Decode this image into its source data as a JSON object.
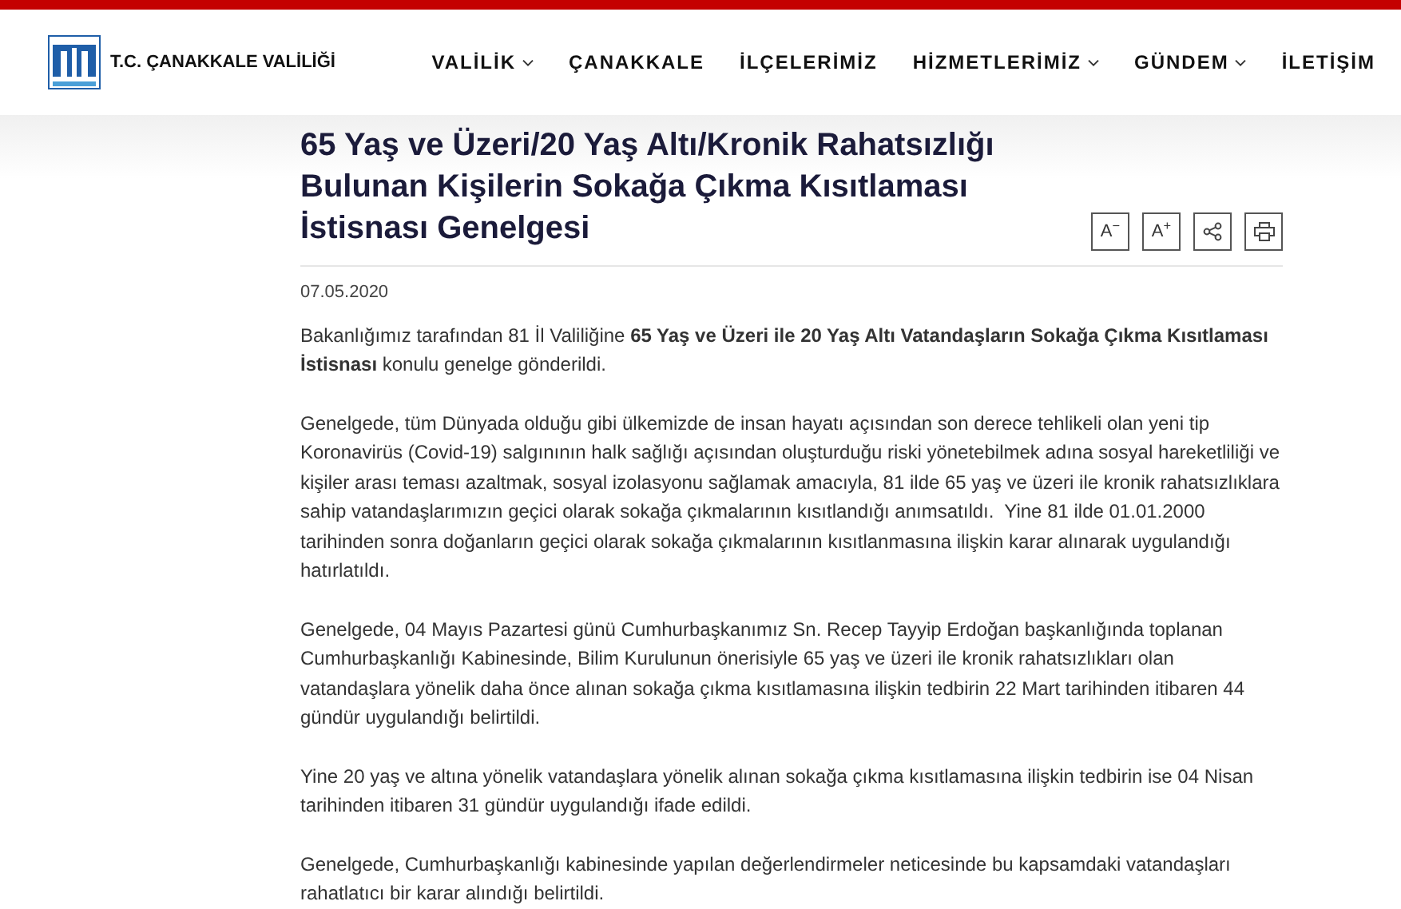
{
  "header": {
    "site_name": "T.C. ÇANAKKALE VALİLİĞİ",
    "nav": [
      {
        "label": "VALİLİK",
        "has_dropdown": true
      },
      {
        "label": "ÇANAKKALE",
        "has_dropdown": false
      },
      {
        "label": "İLÇELERİMİZ",
        "has_dropdown": false
      },
      {
        "label": "HİZMETLERİMİZ",
        "has_dropdown": true
      },
      {
        "label": "GÜNDEM",
        "has_dropdown": true
      },
      {
        "label": "İLETİŞİM",
        "has_dropdown": false
      }
    ]
  },
  "article": {
    "title": "65 Yaş ve Üzeri/20 Yaş Altı/Kronik Rahatsızlığı Bulunan Kişilerin Sokağa Çıkma Kısıtlaması İstisnası Genelgesi",
    "tools": [
      {
        "kind": "text",
        "label": "A$^{−}$"
      },
      {
        "kind": "text",
        "label": "A$^{+}$"
      },
      {
        "kind": "share"
      },
      {
        "kind": "print"
      }
    ],
    "date": "07.05.2020",
    "paragraphs": [
      "Bakanlığımız tarafından 81 İl Valiliğine **65 Yaş ve Üzeri ile 20 Yaş Altı Vatandaşların Sokağa Çıkma Kısıtlaması İstisnası** konulu genelge gönderildi.",
      "Genelgede, tüm Dünyada olduğu gibi ülkemizde de insan hayatı açısından son derece tehlikeli olan yeni tip Koronavirüs (Covid-19) salgınının halk sağlığı açısından oluşturduğu riski yönetebilmek adına sosyal hareketliliği ve kişiler arası teması azaltmak, sosyal izolasyonu sağlamak amacıyla, 81 ilde 65 yaş ve üzeri ile kronik rahatsızlıklara sahip vatandaşlarımızın geçici olarak sokağa çıkmalarının kısıtlandığı anımsatıldı.  Yine 81 ilde 01.01.2000 tarihinden sonra doğanların geçici olarak sokağa çıkmalarının kısıtlanmasına ilişkin karar alınarak uygulandığı hatırlatıldı.",
      "Genelgede, 04 Mayıs Pazartesi günü Cumhurbaşkanımız Sn. Recep Tayyip Erdoğan başkanlığında toplanan Cumhurbaşkanlığı Kabinesinde, Bilim Kurulunun önerisiyle 65 yaş ve üzeri ile kronik rahatsızlıkları olan vatandaşlara yönelik daha önce alınan sokağa çıkma kısıtlamasına ilişkin tedbirin 22 Mart tarihinden itibaren 44 gündür uygulandığı belirtildi.",
      "Yine 20 yaş ve altına yönelik vatandaşlara yönelik alınan sokağa çıkma kısıtlamasına ilişkin tedbirin ise 04 Nisan tarihinden itibaren 31 gündür uygulandığı ifade edildi.",
      "Genelgede, Cumhurbaşkanlığı kabinesinde yapılan değerlendirmeler neticesinde bu kapsamdaki vatandaşları rahatlatıcı bir karar alındığı belirtildi."
    ]
  }
}
